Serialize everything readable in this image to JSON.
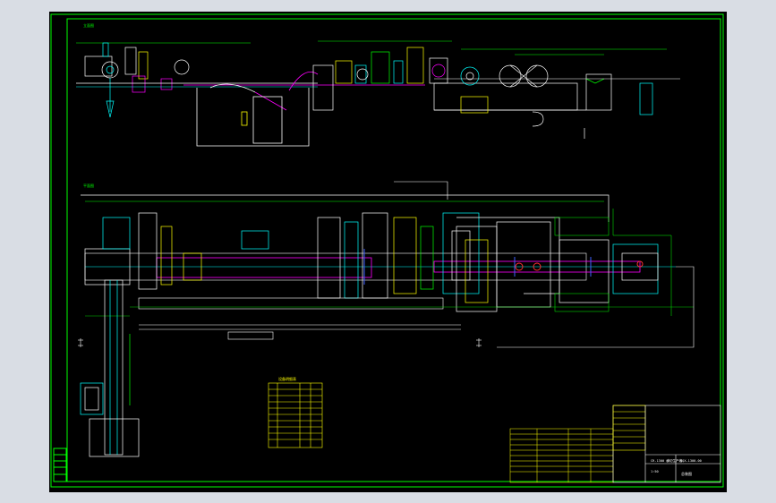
{
  "window": {
    "background": "#d9dde4",
    "model_background": "#000000"
  },
  "colors": {
    "frame": "#00ff00",
    "equipment": "#ffffff",
    "dimensions": "#00ff00",
    "steel": "#ff00ff",
    "machinery": "#00ffff",
    "tables": "#ffff00",
    "accent_red": "#ff3030",
    "accent_blue": "#4060ff"
  },
  "layout_desc": {
    "note_elevation": "立面图",
    "note_plan": "平面图"
  },
  "equipment_table": {
    "title": "设备明细表",
    "rows": 10
  },
  "title_block": {
    "main_title": "CR-1300 横切生产线",
    "drawing_no": "HQX-1300-00",
    "scale": "1:50",
    "stamp": "总装图"
  },
  "revision_block": {
    "rows": 9
  },
  "side_strip": {
    "cells": 5
  }
}
